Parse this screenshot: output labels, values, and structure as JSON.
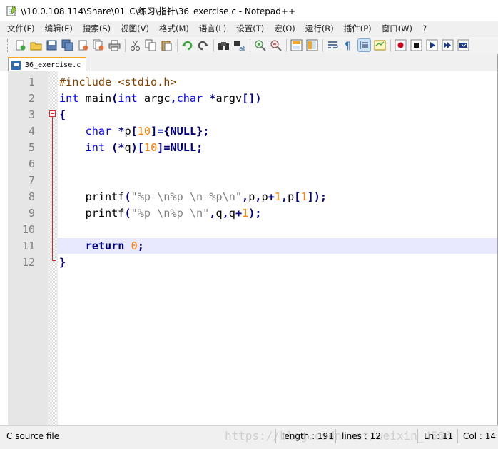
{
  "window": {
    "title": "\\\\10.0.108.114\\Share\\01_C\\练习\\指针\\36_exercise.c - Notepad++"
  },
  "menu": [
    "文件(F)",
    "编辑(E)",
    "搜索(S)",
    "视图(V)",
    "格式(M)",
    "语言(L)",
    "设置(T)",
    "宏(O)",
    "运行(R)",
    "插件(P)",
    "窗口(W)",
    "?"
  ],
  "toolbar": {
    "icons": [
      "new-file-icon",
      "open-file-icon",
      "save-icon",
      "save-all-icon",
      "close-icon",
      "close-all-icon",
      "print-icon",
      "cut-icon",
      "copy-icon",
      "paste-icon",
      "undo-icon",
      "redo-icon",
      "find-icon",
      "replace-icon",
      "zoom-in-icon",
      "zoom-out-icon",
      "sync-vertical-icon",
      "sync-horizontal-icon",
      "word-wrap-icon",
      "show-all-chars-icon",
      "indent-guide-icon",
      "doc-map-icon",
      "record-macro-icon",
      "stop-macro-icon",
      "play-macro-icon",
      "run-macro-multiple-icon",
      "save-macro-icon"
    ]
  },
  "tab": {
    "label": "36_exercise.c"
  },
  "editor": {
    "current_line": 11,
    "lines": [
      {
        "n": "1",
        "text": "#include <stdio.h>"
      },
      {
        "n": "2",
        "text": "int main(int argc,char *argv[])"
      },
      {
        "n": "3",
        "text": "{"
      },
      {
        "n": "4",
        "text": "    char *p[10]={NULL};"
      },
      {
        "n": "5",
        "text": "    int (*q)[10]=NULL;"
      },
      {
        "n": "6",
        "text": ""
      },
      {
        "n": "7",
        "text": ""
      },
      {
        "n": "8",
        "text": "    printf(\"%p \\n%p \\n %p\\n\",p,p+1,p[1]);"
      },
      {
        "n": "9",
        "text": "    printf(\"%p \\n%p \\n\",q,q+1);"
      },
      {
        "n": "10",
        "text": ""
      },
      {
        "n": "11",
        "text": "    return 0;"
      },
      {
        "n": "12",
        "text": "}"
      }
    ]
  },
  "status": {
    "file_type": "C source file",
    "length": "length : 191",
    "lines": "lines : 12",
    "ln": "Ln : 11",
    "col": "Col : 14",
    "watermark": "https://blog.csdn.net/weixin_4566"
  },
  "colors": {
    "keyword": "#0000ff",
    "number": "#ff8000",
    "operator": "#000080",
    "preprocessor": "#804000",
    "string": "#808080",
    "current_line": "#e8e8ff",
    "fold_marker": "#e0282a"
  }
}
